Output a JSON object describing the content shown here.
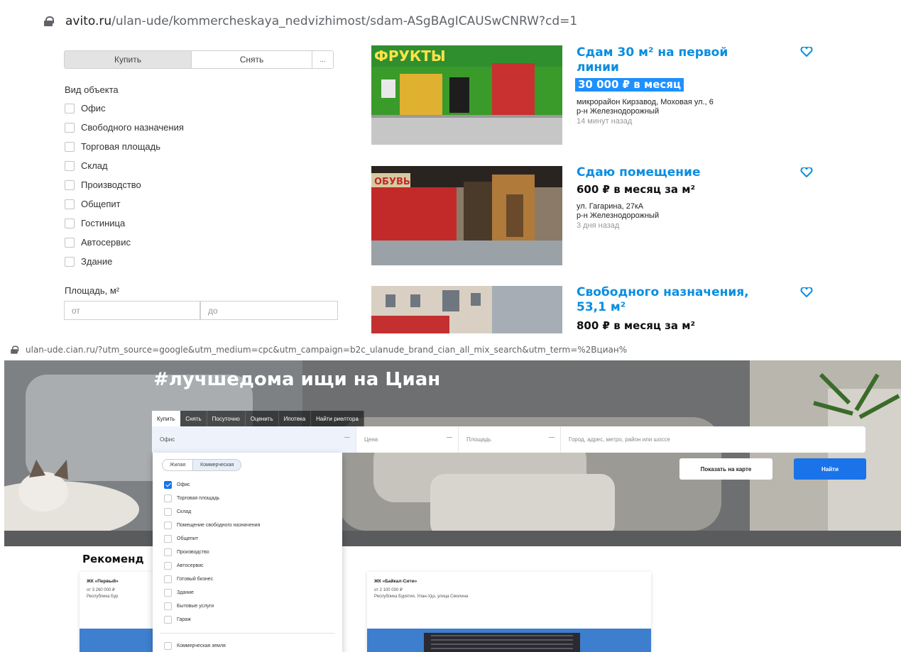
{
  "avito": {
    "url": {
      "host": "avito.ru",
      "path": "/ulan-ude/kommercheskaya_nedvizhimost/sdam-ASgBAgICAUSwCNRW?cd=1"
    },
    "tabs": {
      "buy": "Купить",
      "rent": "Снять",
      "more": "..."
    },
    "object_type": {
      "label": "Вид объекта",
      "options": [
        "Офис",
        "Свободного назначения",
        "Торговая площадь",
        "Склад",
        "Производство",
        "Общепит",
        "Гостиница",
        "Автосервис",
        "Здание"
      ]
    },
    "area": {
      "label": "Площадь, м²",
      "from_placeholder": "от",
      "to_placeholder": "до"
    },
    "listings": [
      {
        "title_line1": "Сдам 30 м² на первой",
        "title_line2": "линии",
        "price": "30 000 ₽ в месяц",
        "address": "микрорайон Кирзавод, Моховая ул., 6",
        "district": "р-н Железнодорожный",
        "date": "14 минут назад"
      },
      {
        "title_line1": "Сдаю помещение",
        "price": "600 ₽ в месяц за м²",
        "address": "ул. Гагарина, 27кА",
        "district": "р-н Железнодорожный",
        "date": "3 дня назад"
      },
      {
        "title_line1": "Свободного назначения,",
        "title_line2": "53,1 м²",
        "price": "800 ₽ в месяц за м²"
      }
    ],
    "photo_sign_1": "ФРУКТЫ",
    "photo_sign_2": "ОБУВЬ"
  },
  "cian": {
    "url": "ulan-ude.cian.ru/?utm_source=google&utm_medium=cpc&utm_campaign=b2c_ulanude_brand_cian_all_mix_search&utm_term=%2Bциан%",
    "hero_title": "#лучшедома ищи на Циан",
    "tabs": [
      "Купить",
      "Снять",
      "Посуточно",
      "Оценить",
      "Ипотека",
      "Найти риелтора"
    ],
    "search": {
      "type_value": "Офис",
      "price_placeholder": "Цена",
      "area_placeholder": "Площадь",
      "location_placeholder": "Город, адрес, метро, район или шоссе"
    },
    "buttons": {
      "map": "Показать на карте",
      "find": "Найти"
    },
    "dropdown": {
      "toggle": [
        "Жилая",
        "Коммерческая"
      ],
      "options": [
        "Офис",
        "Торговая площадь",
        "Склад",
        "Помещение свободного назначения",
        "Общепит",
        "Производство",
        "Автосервис",
        "Готовый бизнес",
        "Здание",
        "Бытовые услуги",
        "Гараж"
      ],
      "extra": "Коммерческая земля",
      "checked_index": 0
    },
    "recommend_title": "Рекоменд",
    "cards": [
      {
        "name": "ЖК «Первый»",
        "price": "от 3 260 000 ₽",
        "address": "Республика Бур"
      },
      {
        "name": "ЖК «Байкал-Сити»",
        "price": "от 2 100 000 ₽",
        "address": "Республика Бурятия, Улан-Удэ, улица Смолина"
      }
    ]
  },
  "colors": {
    "avito_link": "#0a8ee0",
    "avito_highlight": "#1e90ff",
    "cian_blue": "#1a73e8"
  }
}
